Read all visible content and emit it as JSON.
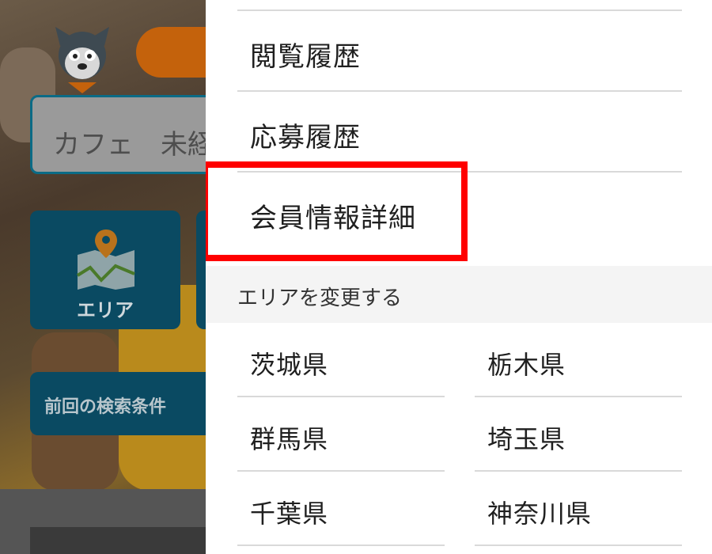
{
  "background": {
    "search_text": "カフェ　未経",
    "area_tile_label": "エリア",
    "prev_search_label": "前回の検索条件"
  },
  "drawer": {
    "menu": [
      {
        "label": "閲覧履歴"
      },
      {
        "label": "応募履歴"
      },
      {
        "label": "会員情報詳細"
      }
    ],
    "area_section_title": "エリアを変更する",
    "prefectures": [
      {
        "label": "茨城県"
      },
      {
        "label": "栃木県"
      },
      {
        "label": "群馬県"
      },
      {
        "label": "埼玉県"
      },
      {
        "label": "千葉県"
      },
      {
        "label": "神奈川県"
      }
    ]
  },
  "colors": {
    "highlight": "#ff0000",
    "brand_teal": "#0a4a62",
    "brand_orange": "#c4620c"
  }
}
